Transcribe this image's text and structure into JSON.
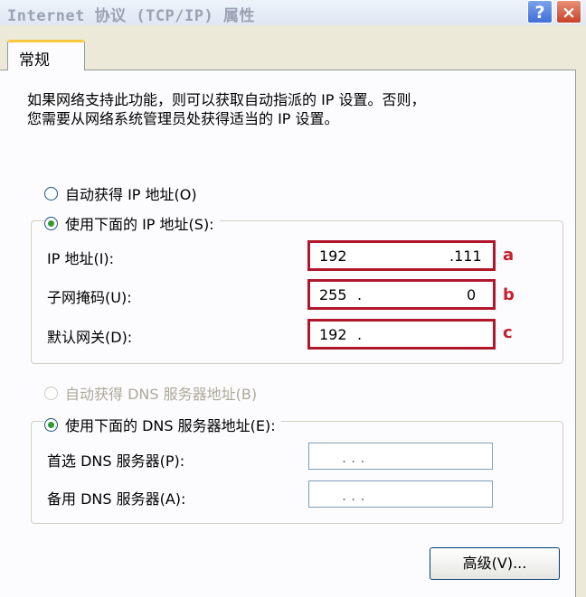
{
  "window": {
    "title": "Internet 协议 (TCP/IP) 属性",
    "help_button": "?",
    "close_button": "×"
  },
  "tab": {
    "label": "常规"
  },
  "description": {
    "line1": "如果网络支持此功能，则可以获取自动指派的 IP 设置。否则，",
    "line2": "您需要从网络系统管理员处获得适当的 IP 设置。"
  },
  "ip": {
    "auto_label": "自动获得 IP 地址(O)",
    "manual_label": "使用下面的 IP 地址(S):",
    "selected": "manual",
    "address_label": "IP 地址(I):",
    "address_value_start": "192",
    "address_value_end": ".111",
    "address_marker": "a",
    "subnet_label": "子网掩码(U):",
    "subnet_value_start": "255",
    "subnet_value_dot": ".",
    "subnet_value_end": "0",
    "subnet_marker": "b",
    "gateway_label": "默认网关(D):",
    "gateway_value_start": "192",
    "gateway_value_dot": ".",
    "gateway_marker": "c"
  },
  "dns": {
    "auto_label": "自动获得 DNS 服务器地址(B)",
    "manual_label": "使用下面的 DNS 服务器地址(E):",
    "selected": "manual",
    "preferred_label": "首选 DNS 服务器(P):",
    "alternate_label": "备用 DNS 服务器(A):",
    "empty_dots": ".   .   ."
  },
  "advanced_button": "高级(V)...",
  "colors": {
    "highlight_border": "#b0172b",
    "marker": "#c51f2d",
    "radio_dot": "#2f9a2f"
  }
}
